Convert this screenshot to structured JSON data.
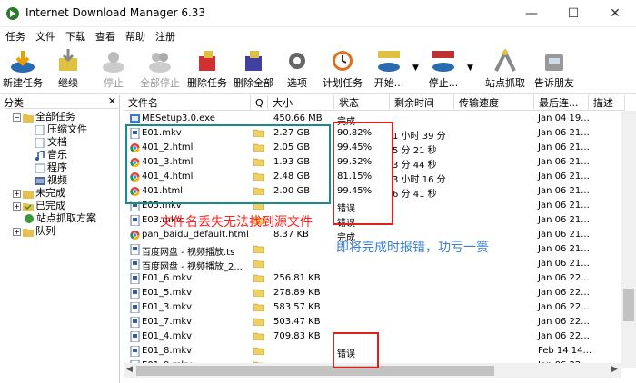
{
  "window": {
    "title": "Internet Download Manager 6.33",
    "minimize": "—",
    "maximize": "☐",
    "close": "✕"
  },
  "menu": [
    "任务",
    "文件",
    "下载",
    "查看",
    "帮助",
    "注册"
  ],
  "toolbar": [
    {
      "label": "新建任务",
      "icon": "new-task-icon",
      "enabled": true
    },
    {
      "label": "继续",
      "icon": "resume-icon",
      "enabled": true
    },
    {
      "label": "停止",
      "icon": "stop-icon",
      "enabled": false
    },
    {
      "label": "全部停止",
      "icon": "stop-all-icon",
      "enabled": false
    },
    {
      "label": "删除任务",
      "icon": "delete-task-icon",
      "enabled": true
    },
    {
      "label": "删除全部",
      "icon": "delete-all-icon",
      "enabled": true
    },
    {
      "label": "选项",
      "icon": "options-gear-icon",
      "enabled": true
    },
    {
      "label": "计划任务",
      "icon": "scheduler-clock-icon",
      "enabled": true
    },
    {
      "label": "开始...",
      "icon": "start-queue-icon",
      "enabled": true
    },
    {
      "label": "停止...",
      "icon": "stop-queue-icon",
      "enabled": true
    },
    {
      "label": "站点抓取",
      "icon": "site-grabber-icon",
      "enabled": true
    },
    {
      "label": "告诉朋友",
      "icon": "tell-friend-icon",
      "enabled": true
    }
  ],
  "sidebar": {
    "header": "分类",
    "close": "✕",
    "tree": [
      {
        "label": "全部任务",
        "level": 0,
        "expand": "−",
        "icon": "folder-open-icon"
      },
      {
        "label": "压缩文件",
        "level": 1,
        "icon": "archive-icon"
      },
      {
        "label": "文档",
        "level": 1,
        "icon": "document-icon"
      },
      {
        "label": "音乐",
        "level": 1,
        "icon": "music-icon"
      },
      {
        "label": "程序",
        "level": 1,
        "icon": "program-icon"
      },
      {
        "label": "视频",
        "level": 1,
        "icon": "video-icon"
      },
      {
        "label": "未完成",
        "level": 0,
        "expand": "+",
        "icon": "folder-icon"
      },
      {
        "label": "已完成",
        "level": 0,
        "expand": "+",
        "icon": "folder-check-icon"
      },
      {
        "label": "站点抓取方案",
        "level": 0,
        "icon": "grabber-project-icon"
      },
      {
        "label": "队列",
        "level": 0,
        "expand": "+",
        "icon": "folder-icon"
      }
    ]
  },
  "columns": [
    "文件名",
    "Q",
    "大小",
    "状态",
    "剩余时间",
    "传输速度",
    "最后连...",
    "描述"
  ],
  "rows": [
    {
      "name": "MESetup3.0.exe",
      "q": "",
      "size": "450.66  MB",
      "status": "完成",
      "time": "",
      "date": "Jan 04 19...",
      "icon": "exe"
    },
    {
      "name": "E01.mkv",
      "q": "folder",
      "size": "2.27  GB",
      "status": "90.82%",
      "time": "1 小时 39 分",
      "date": "Jan 06 21...",
      "icon": "video"
    },
    {
      "name": "401_2.html",
      "q": "folder",
      "size": "2.05  GB",
      "status": "99.45%",
      "time": "5 分 21 秒",
      "date": "Jan 06 21...",
      "icon": "chrome"
    },
    {
      "name": "401_3.html",
      "q": "folder",
      "size": "1.93  GB",
      "status": "99.52%",
      "time": "3 分 44 秒",
      "date": "Jan 06 21...",
      "icon": "chrome"
    },
    {
      "name": "401_4.html",
      "q": "folder",
      "size": "2.48  GB",
      "status": "81.15%",
      "time": "3 小时 16 分",
      "date": "Jan 06 21...",
      "icon": "chrome"
    },
    {
      "name": "401.html",
      "q": "folder",
      "size": "2.00  GB",
      "status": "99.45%",
      "time": "6 分 41 秒",
      "date": "Jan 06 21...",
      "icon": "chrome"
    },
    {
      "name": "E05.mkv",
      "q": "folder",
      "size": "",
      "status": "错误",
      "time": "",
      "date": "Jan 06 21...",
      "icon": "video"
    },
    {
      "name": "E03.mkv",
      "q": "folder",
      "size": "",
      "status": "错误",
      "time": "",
      "date": "Jan 06 21...",
      "icon": "video"
    },
    {
      "name": "pan_baidu_default.html",
      "q": "",
      "size": "8.37  KB",
      "status": "完成",
      "time": "",
      "date": "Jan 06 21...",
      "icon": "chrome"
    },
    {
      "name": "百度网盘 - 视频播放.ts",
      "q": "folder",
      "size": "",
      "status": "",
      "time": "",
      "date": "Jan 06 21...",
      "icon": "video"
    },
    {
      "name": "百度网盘 - 视频播放_2...",
      "q": "folder",
      "size": "",
      "status": "",
      "time": "",
      "date": "Jan 06 21...",
      "icon": "video"
    },
    {
      "name": "E01_6.mkv",
      "q": "folder",
      "size": "256.81  KB",
      "status": "",
      "time": "",
      "date": "Jan 06 22...",
      "icon": "video"
    },
    {
      "name": "E01_5.mkv",
      "q": "folder",
      "size": "278.89  KB",
      "status": "",
      "time": "",
      "date": "Jan 06 22...",
      "icon": "video"
    },
    {
      "name": "E01_3.mkv",
      "q": "folder",
      "size": "583.57  KB",
      "status": "",
      "time": "",
      "date": "Jan 06 22...",
      "icon": "video"
    },
    {
      "name": "E01_7.mkv",
      "q": "folder",
      "size": "503.47  KB",
      "status": "",
      "time": "",
      "date": "Jan 06 22...",
      "icon": "video"
    },
    {
      "name": "E01_4.mkv",
      "q": "folder",
      "size": "709.83  KB",
      "status": "",
      "time": "",
      "date": "Jan 06 22...",
      "icon": "video"
    },
    {
      "name": "E01_8.mkv",
      "q": "folder",
      "size": "",
      "status": "错误",
      "time": "",
      "date": "Feb 14 14...",
      "icon": "video"
    },
    {
      "name": "E01_9.mkv",
      "q": "folder",
      "size": "",
      "status": "错误",
      "time": "",
      "date": "Jan 06 22...",
      "icon": "video"
    }
  ],
  "annotations": {
    "missing_source": "文件名丢失无法找到源文件",
    "will_error": "即将完成时报错，功亏一篑"
  },
  "colors": {
    "teal_box": "#1a8a8a",
    "red_box": "#e02020",
    "red_text": "#ff2020",
    "blue_text": "#3a7fd5"
  }
}
